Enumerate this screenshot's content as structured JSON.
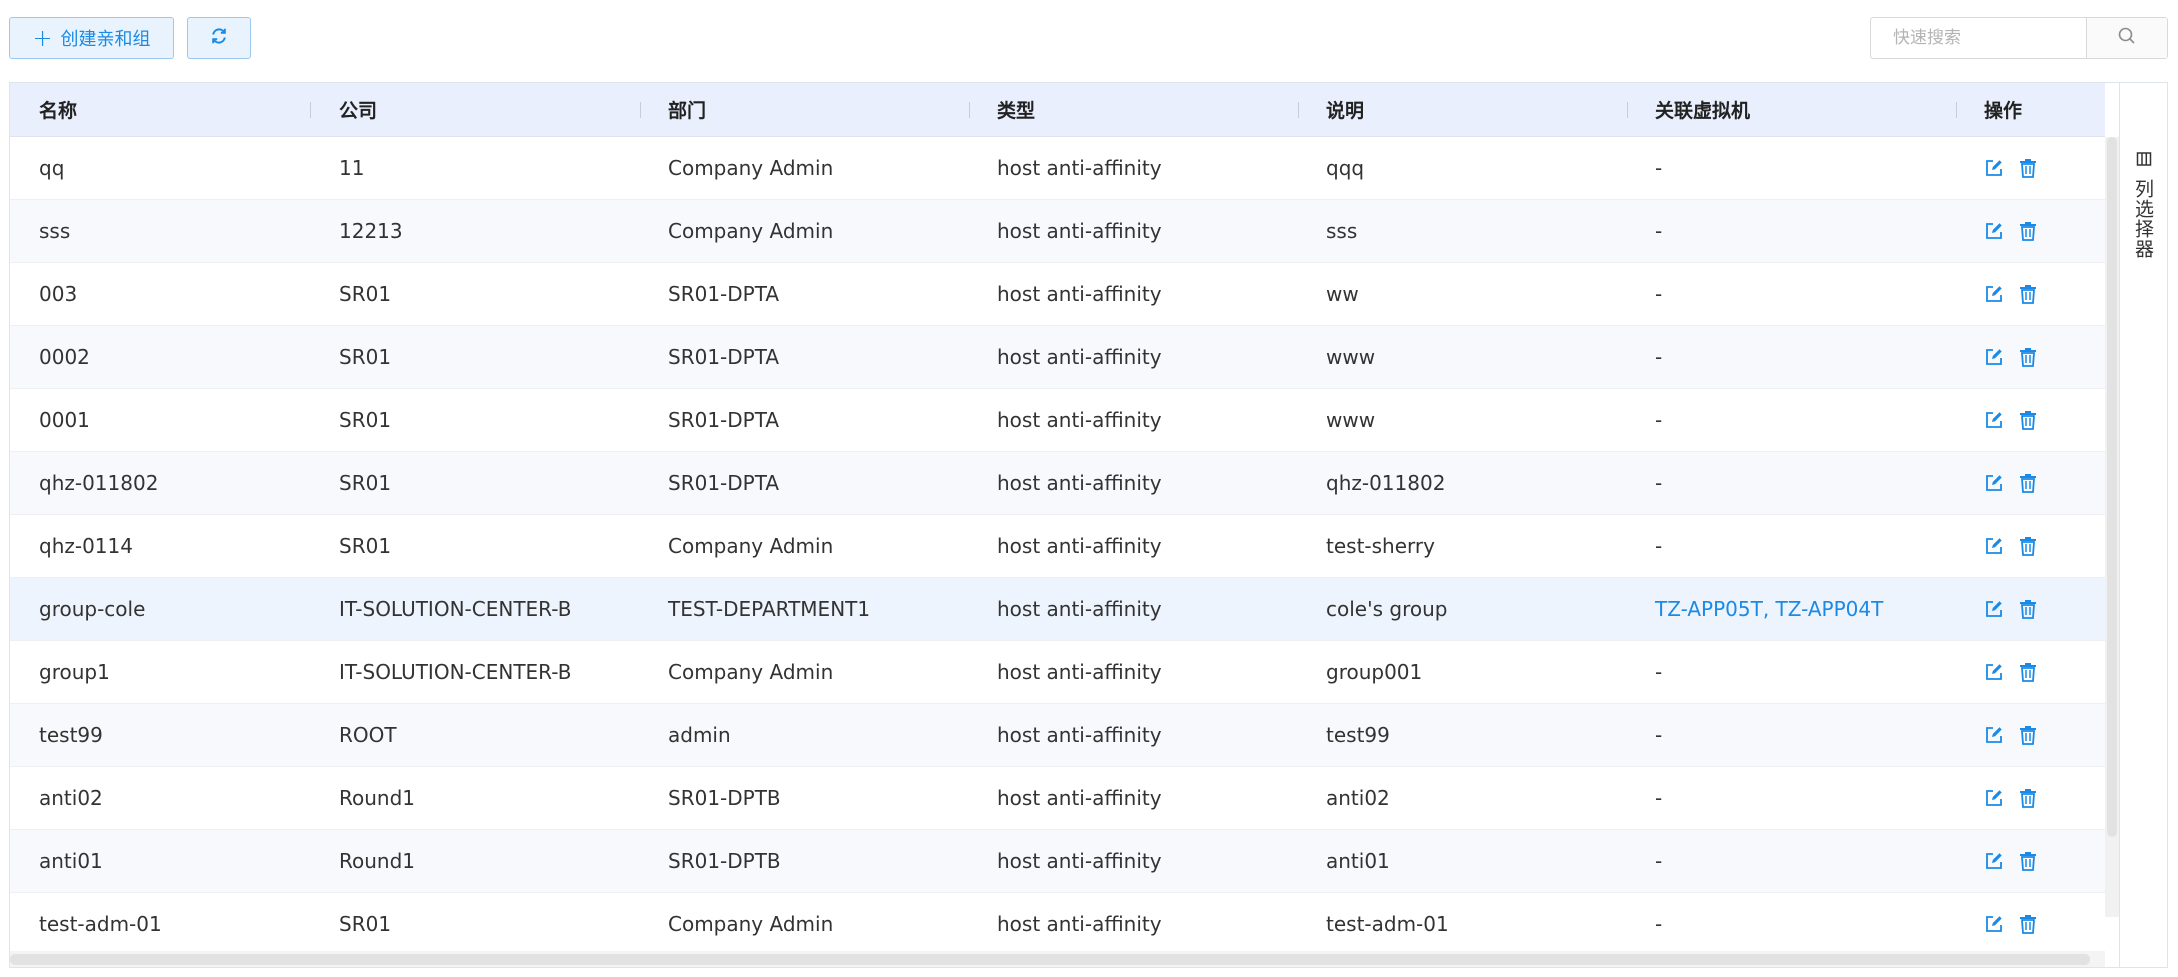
{
  "toolbar": {
    "create_label": "创建亲和组",
    "create_icon": "plus-icon",
    "refresh_icon": "refresh-icon"
  },
  "search": {
    "placeholder": "快速搜索",
    "value": "",
    "icon": "search-icon"
  },
  "columns": [
    "名称",
    "公司",
    "部门",
    "类型",
    "说明",
    "关联虚拟机",
    "操作"
  ],
  "rows": [
    {
      "name": "qq",
      "company": "11",
      "department": "Company Admin",
      "type": "host anti-affinity",
      "description": "qqq",
      "vms": [
        "-"
      ]
    },
    {
      "name": "sss",
      "company": "12213",
      "department": "Company Admin",
      "type": "host anti-affinity",
      "description": "sss",
      "vms": [
        "-"
      ]
    },
    {
      "name": "003",
      "company": "SR01",
      "department": "SR01-DPTA",
      "type": "host anti-affinity",
      "description": "ww",
      "vms": [
        "-"
      ]
    },
    {
      "name": "0002",
      "company": "SR01",
      "department": "SR01-DPTA",
      "type": "host anti-affinity",
      "description": "www",
      "vms": [
        "-"
      ]
    },
    {
      "name": "0001",
      "company": "SR01",
      "department": "SR01-DPTA",
      "type": "host anti-affinity",
      "description": "www",
      "vms": [
        "-"
      ]
    },
    {
      "name": "qhz-011802",
      "company": "SR01",
      "department": "SR01-DPTA",
      "type": "host anti-affinity",
      "description": "qhz-011802",
      "vms": [
        "-"
      ]
    },
    {
      "name": "qhz-0114",
      "company": "SR01",
      "department": "Company Admin",
      "type": "host anti-affinity",
      "description": "test-sherry",
      "vms": [
        "-"
      ]
    },
    {
      "name": "group-cole",
      "company": "IT-SOLUTION-CENTER-B",
      "department": "TEST-DEPARTMENT1",
      "type": "host anti-affinity",
      "description": "cole's group",
      "vms": [
        "TZ-APP05T",
        "TZ-APP04T"
      ]
    },
    {
      "name": "group1",
      "company": "IT-SOLUTION-CENTER-B",
      "department": "Company Admin",
      "type": "host anti-affinity",
      "description": "group001",
      "vms": [
        "-"
      ]
    },
    {
      "name": "test99",
      "company": "ROOT",
      "department": "admin",
      "type": "host anti-affinity",
      "description": "test99",
      "vms": [
        "-"
      ]
    },
    {
      "name": "anti02",
      "company": "Round1",
      "department": "SR01-DPTB",
      "type": "host anti-affinity",
      "description": "anti02",
      "vms": [
        "-"
      ]
    },
    {
      "name": "anti01",
      "company": "Round1",
      "department": "SR01-DPTB",
      "type": "host anti-affinity",
      "description": "anti01",
      "vms": [
        "-"
      ]
    },
    {
      "name": "test-adm-01",
      "company": "SR01",
      "department": "Company Admin",
      "type": "host anti-affinity",
      "description": "test-adm-01",
      "vms": [
        "-"
      ]
    }
  ],
  "row_actions": [
    "edit-icon",
    "delete-icon"
  ],
  "column_picker": {
    "label": "列选择器",
    "icon": "columns-icon"
  },
  "colors": {
    "accent": "#1a8ae6",
    "header_bg": "#e9effd",
    "highlight_row_bg": "#eef4fd"
  }
}
